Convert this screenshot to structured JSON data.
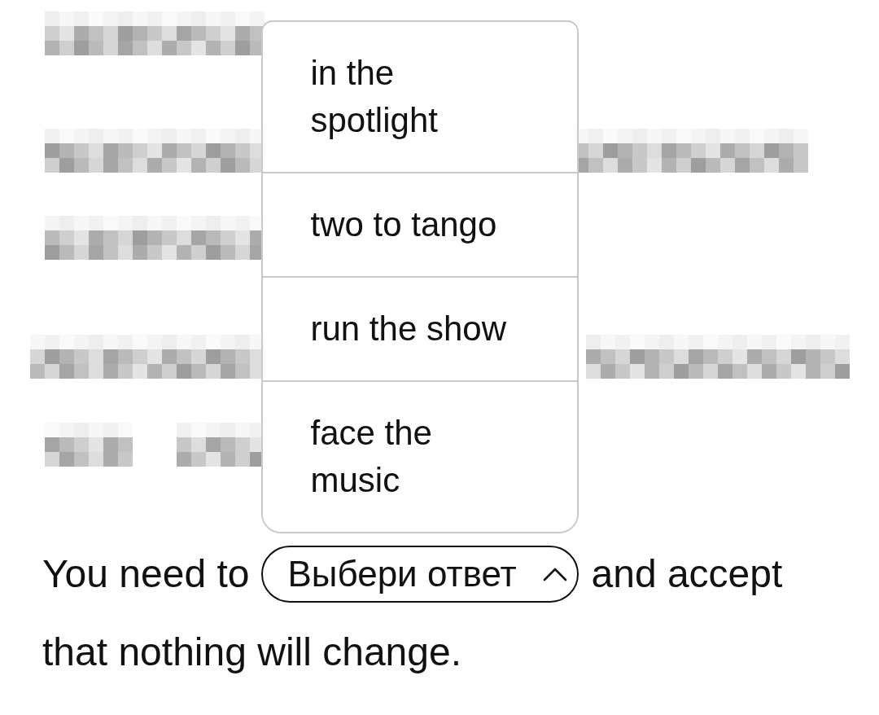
{
  "sentence": {
    "before": "You need to",
    "dropdown": {
      "placeholder": "Выбери ответ",
      "expanded": true,
      "options": [
        {
          "label": "in the spotlight",
          "selected": false
        },
        {
          "label": "two to tango",
          "selected": false
        },
        {
          "label": "run the show",
          "selected": false
        },
        {
          "label": "face the music",
          "selected": false
        }
      ]
    },
    "after": [
      "and accept",
      "that nothing will change."
    ]
  }
}
